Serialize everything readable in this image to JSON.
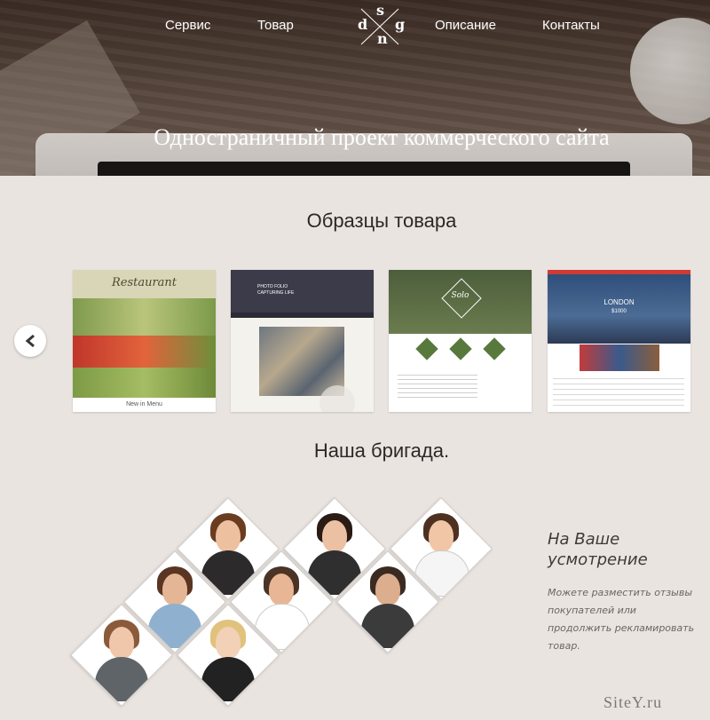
{
  "nav": {
    "items": [
      "Сервис",
      "Товар",
      "Описание",
      "Контакты"
    ],
    "logo_letters": {
      "top": "s",
      "left": "d",
      "right": "g",
      "bottom": "n"
    }
  },
  "hero": {
    "title": "Одностраничный проект коммерческого сайта"
  },
  "samples": {
    "title": "Образцы товара",
    "thumbs": [
      {
        "heading": "Restaurant",
        "caption": "New in Menu"
      },
      {
        "heading": "PHOTO FOLIO CAPTURING LIFE",
        "caption": ""
      },
      {
        "heading": "Solo",
        "caption": ""
      },
      {
        "heading": "LONDON",
        "caption": "$1000"
      }
    ]
  },
  "team": {
    "title": "Наша бригада.",
    "aside_title": "На Ваше усмотрение",
    "aside_text": "Можете разместить отзывы покупателей или продолжить рекламировать товар."
  },
  "watermark": "SiteY.ru",
  "colors": {
    "background": "#e9e4e0",
    "text": "#2b2826"
  }
}
